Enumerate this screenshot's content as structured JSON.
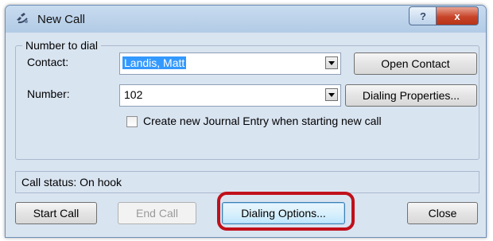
{
  "window": {
    "title": "New Call",
    "help_label": "?",
    "close_label": "x"
  },
  "group": {
    "legend": "Number to dial"
  },
  "contact": {
    "label": "Contact:",
    "value": "Landis, Matt",
    "button": "Open Contact"
  },
  "number": {
    "label": "Number:",
    "value": "102",
    "button": "Dialing Properties..."
  },
  "journal": {
    "label": "Create new Journal Entry when starting new call",
    "checked": false
  },
  "status": {
    "text": "Call status:  On hook"
  },
  "buttons": {
    "start": "Start Call",
    "end": "End Call",
    "options": "Dialing Options...",
    "close": "Close"
  },
  "colors": {
    "highlight": "#c0101a",
    "selection": "#3399ff"
  }
}
